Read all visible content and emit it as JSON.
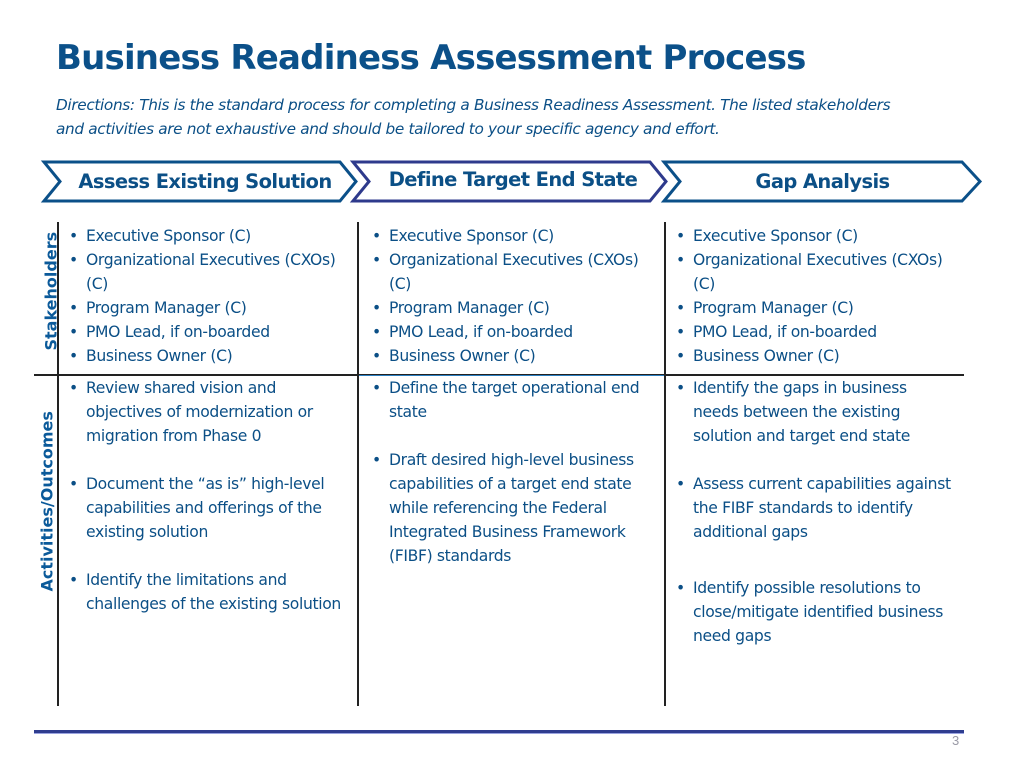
{
  "title": "Business Readiness Assessment Process",
  "directions": "Directions: This is the standard process for completing a Business Readiness Assessment. The listed stakeholders and activities are not exhaustive and should be tailored to your specific agency and effort.",
  "phases": [
    {
      "label": "Assess Existing Solution",
      "border_color": "#0b5089"
    },
    {
      "label": "Define Target End State",
      "border_color": "#2e3a8c"
    },
    {
      "label": "Gap Analysis",
      "border_color": "#0b5089"
    }
  ],
  "row_labels": {
    "stakeholders": "Stakeholders",
    "activities": "Activities/Outcomes"
  },
  "stakeholders": [
    [
      "Executive Sponsor (C)",
      "Organizational Executives (CXOs) (C)",
      "Program Manager (C)",
      "PMO Lead, if on-boarded",
      "Business Owner (C)"
    ],
    [
      "Executive Sponsor (C)",
      "Organizational Executives (CXOs) (C)",
      "Program Manager (C)",
      "PMO Lead, if on-boarded",
      "Business Owner (C)"
    ],
    [
      "Executive Sponsor (C)",
      "Organizational Executives (CXOs) (C)",
      "Program Manager (C)",
      "PMO Lead, if on-boarded",
      "Business Owner (C)"
    ]
  ],
  "activities": [
    [
      "Review shared vision and objectives of modernization or migration from Phase 0",
      "Document the “as is” high-level capabilities and offerings of the existing solution",
      "Identify the limitations and challenges of the existing solution"
    ],
    [
      "Define the target operational end state",
      "Draft desired high-level business capabilities of a target end state while referencing the Federal Integrated Business Framework (FIBF) standards"
    ],
    [
      "Identify the gaps in business needs between the existing solution and target end state",
      "Assess current capabilities against the FIBF standards to identify additional gaps",
      "Identify possible resolutions to close/mitigate identified business need gaps"
    ]
  ],
  "page_number": "3"
}
